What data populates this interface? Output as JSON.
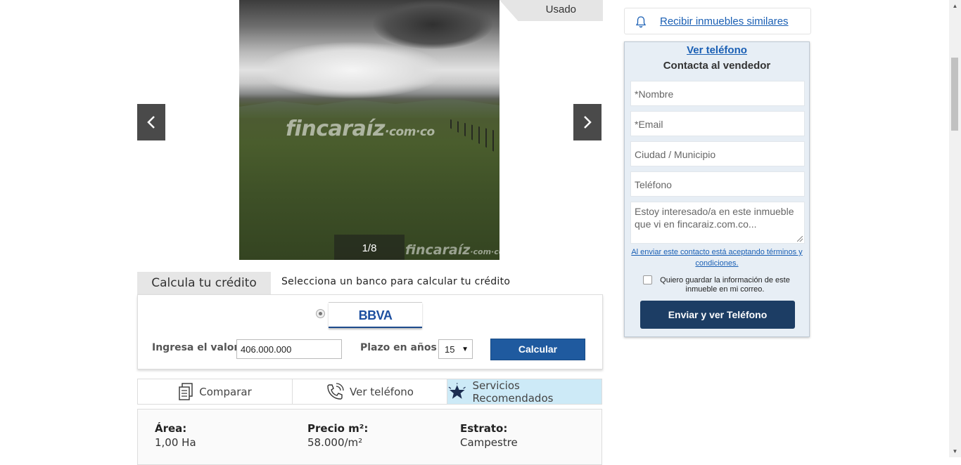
{
  "gallery": {
    "badge": "Usado",
    "counter": "1/8",
    "watermark_main": "fincaraíz",
    "watermark_suffix": "·com·co"
  },
  "credit": {
    "tab_label": "Calcula tu crédito",
    "subtitle": "Selecciona un banco para calcular tu crédito",
    "bank_name": "BBVA",
    "value_label": "Ingresa el valor",
    "value": "406.000.000",
    "term_label": "Plazo en años",
    "term_value": "15",
    "calc_button": "Calcular"
  },
  "actions": {
    "compare": "Comparar",
    "phone": "Ver teléfono",
    "services": "Servicios Recomendados"
  },
  "specs": {
    "area_label": "Área:",
    "area_value": "1,00 Ha",
    "price_label": "Precio m²:",
    "price_value": "58.000/m²",
    "stratum_label": "Estrato:",
    "stratum_value": "Campestre"
  },
  "sidebar": {
    "similar_link": "Recibir inmuebles similares",
    "phone_link": "Ver teléfono",
    "contact_title": "Contacta al vendedor",
    "name_placeholder": "*Nombre",
    "email_placeholder": "*Email",
    "city_placeholder": "Ciudad / Municipio",
    "phone_placeholder": "Teléfono",
    "message_placeholder": "Estoy interesado/a en este inmueble que vi en fincaraiz.com.co...",
    "terms_text": "Al enviar este contacto está aceptando términos y condiciones.",
    "save_text": "Quiero guardar la información de este inmueble en mi correo.",
    "send_button": "Enviar y ver Teléfono"
  },
  "colors": {
    "primary_button": "#1f5a9f",
    "send_button": "#1c3d64",
    "link": "#1a5fb4",
    "highlight_tab": "#cdeaf7"
  }
}
